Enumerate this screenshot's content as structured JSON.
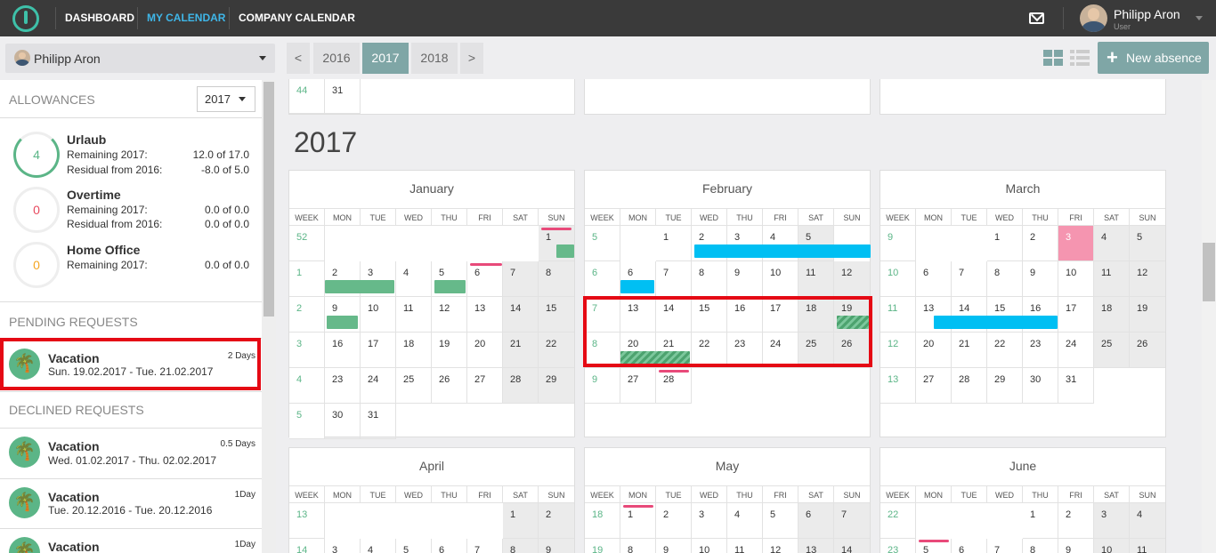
{
  "nav": {
    "dashboard": "DASHBOARD",
    "my_calendar": "MY CALENDAR",
    "company_calendar": "COMPANY CALENDAR"
  },
  "user": {
    "name": "Philipp Aron",
    "role": "User"
  },
  "toolbar": {
    "user_select": "Philipp Aron",
    "prev": "<",
    "next": ">",
    "years": [
      "2016",
      "2017",
      "2018"
    ],
    "active_year": "2017",
    "new_absence": "New absence"
  },
  "sidebar": {
    "allowances_title": "ALLOWANCES",
    "allowances_year": "2017",
    "allowances": [
      {
        "name": "Urlaub",
        "ring": "4",
        "color": "#5bb587",
        "rows": [
          {
            "label": "Remaining 2017:",
            "value": "12.0  of   17.0"
          },
          {
            "label": "Residual from 2016:",
            "value": "-8.0  of    5.0"
          }
        ]
      },
      {
        "name": "Overtime",
        "ring": "0",
        "color": "#e84a5f",
        "rows": [
          {
            "label": "Remaining 2017:",
            "value": "0.0  of    0.0"
          },
          {
            "label": "Residual from 2016:",
            "value": "0.0  of    0.0"
          }
        ]
      },
      {
        "name": "Home Office",
        "ring": "0",
        "color": "#f5a623",
        "rows": [
          {
            "label": "Remaining 2017:",
            "value": "0.0  of    0.0"
          }
        ]
      }
    ],
    "pending_title": "PENDING REQUESTS",
    "pending": [
      {
        "title": "Vacation",
        "date": "Sun. 19.02.2017 - Tue. 21.02.2017",
        "days": "2 Days"
      }
    ],
    "declined_title": "DECLINED REQUESTS",
    "declined": [
      {
        "title": "Vacation",
        "date": "Wed. 01.02.2017 - Thu. 02.02.2017",
        "days": "0.5 Days"
      },
      {
        "title": "Vacation",
        "date": "Tue. 20.12.2016 - Tue. 20.12.2016",
        "days": "1Day"
      },
      {
        "title": "Vacation",
        "date": "",
        "days": "1Day"
      }
    ]
  },
  "calendar": {
    "year": "2017",
    "weekday_headers": [
      "WEEK",
      "MON",
      "TUE",
      "WED",
      "THU",
      "FRI",
      "SAT",
      "SUN"
    ],
    "prev_row": {
      "week": "44",
      "day": "31"
    },
    "colors": {
      "vacation": "#66b98a",
      "other": "#00bff3",
      "pending": "#4da36f",
      "holiday": "#f595b0"
    },
    "months": [
      {
        "name": "January",
        "weeks": [
          {
            "w": "52",
            "days": [
              "",
              "",
              "",
              "",
              "",
              "",
              "1"
            ]
          },
          {
            "w": "1",
            "days": [
              "2",
              "3",
              "4",
              "5",
              "6",
              "7",
              "8"
            ]
          },
          {
            "w": "2",
            "days": [
              "9",
              "10",
              "11",
              "12",
              "13",
              "14",
              "15"
            ]
          },
          {
            "w": "3",
            "days": [
              "16",
              "17",
              "18",
              "19",
              "20",
              "21",
              "22"
            ]
          },
          {
            "w": "4",
            "days": [
              "23",
              "24",
              "25",
              "26",
              "27",
              "28",
              "29"
            ]
          },
          {
            "w": "5",
            "days": [
              "30",
              "31",
              "",
              "",
              "",
              "",
              ""
            ]
          }
        ]
      },
      {
        "name": "February",
        "weeks": [
          {
            "w": "5",
            "days": [
              "",
              "1",
              "2",
              "3",
              "4",
              "5",
              ""
            ]
          },
          {
            "w": "6",
            "days": [
              "6",
              "7",
              "8",
              "9",
              "10",
              "11",
              "12"
            ]
          },
          {
            "w": "7",
            "days": [
              "13",
              "14",
              "15",
              "16",
              "17",
              "18",
              "19"
            ]
          },
          {
            "w": "8",
            "days": [
              "20",
              "21",
              "22",
              "23",
              "24",
              "25",
              "26"
            ]
          },
          {
            "w": "9",
            "days": [
              "27",
              "28",
              "",
              "",
              "",
              "",
              ""
            ]
          }
        ]
      },
      {
        "name": "March",
        "weeks": [
          {
            "w": "9",
            "days": [
              "",
              "",
              "1",
              "2",
              "3",
              "4",
              "5"
            ]
          },
          {
            "w": "10",
            "days": [
              "6",
              "7",
              "8",
              "9",
              "10",
              "11",
              "12"
            ]
          },
          {
            "w": "11",
            "days": [
              "13",
              "14",
              "15",
              "16",
              "17",
              "18",
              "19"
            ]
          },
          {
            "w": "12",
            "days": [
              "20",
              "21",
              "22",
              "23",
              "24",
              "25",
              "26"
            ]
          },
          {
            "w": "13",
            "days": [
              "27",
              "28",
              "29",
              "30",
              "31",
              "",
              ""
            ]
          }
        ]
      },
      {
        "name": "April",
        "weeks": [
          {
            "w": "13",
            "days": [
              "",
              "",
              "",
              "",
              "",
              "1",
              "2"
            ]
          },
          {
            "w": "14",
            "days": [
              "3",
              "4",
              "5",
              "6",
              "7",
              "8",
              "9"
            ]
          }
        ]
      },
      {
        "name": "May",
        "weeks": [
          {
            "w": "18",
            "days": [
              "1",
              "2",
              "3",
              "4",
              "5",
              "6",
              "7"
            ]
          },
          {
            "w": "19",
            "days": [
              "8",
              "9",
              "10",
              "11",
              "12",
              "13",
              "14"
            ]
          }
        ]
      },
      {
        "name": "June",
        "weeks": [
          {
            "w": "22",
            "days": [
              "",
              "",
              "",
              "1",
              "2",
              "3",
              "4"
            ]
          },
          {
            "w": "23",
            "days": [
              "5",
              "6",
              "7",
              "8",
              "9",
              "10",
              "11"
            ]
          }
        ]
      }
    ]
  }
}
